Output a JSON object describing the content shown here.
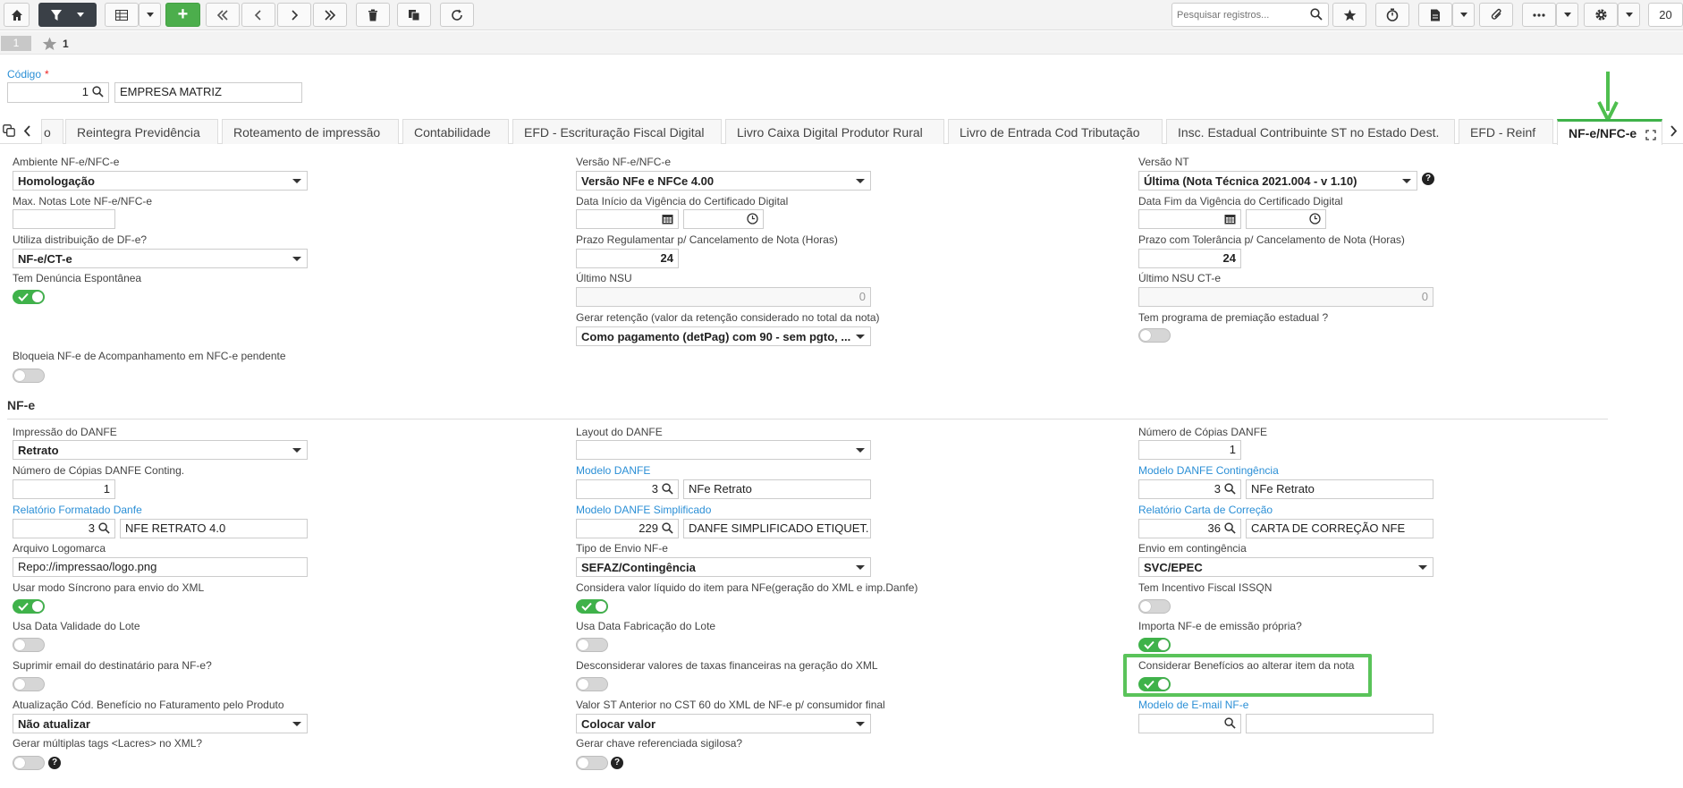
{
  "toolbar": {
    "search_placeholder": "Pesquisar registros...",
    "page_size": "20",
    "icons": [
      "home-icon",
      "filter-icon",
      "table-icon",
      "plus-icon",
      "first-icon",
      "prev-icon",
      "next-icon",
      "last-icon",
      "trash-icon",
      "copy-icon",
      "refresh-icon",
      "star-icon",
      "timer-icon",
      "document-icon",
      "paperclip-icon",
      "ellipsis-icon",
      "gear-icon"
    ],
    "add_label": "+"
  },
  "record_bar": {
    "tab_number": "1",
    "favorite_count": "1"
  },
  "header": {
    "code_label": "Código",
    "required_mark": "*",
    "code_value": "1",
    "company_name": "EMPRESA MATRIZ"
  },
  "tabs": [
    {
      "label": "o"
    },
    {
      "label": "Reintegra Previdência"
    },
    {
      "label": "Roteamento de impressão"
    },
    {
      "label": "Contabilidade"
    },
    {
      "label": "EFD - Escrituração Fiscal Digital"
    },
    {
      "label": "Livro Caixa Digital Produtor Rural"
    },
    {
      "label": "Livro de Entrada Cod Tributação"
    },
    {
      "label": "Insc. Estadual Contribuinte ST no Estado Dest."
    },
    {
      "label": "EFD - Reinf"
    },
    {
      "label": "NF-e/NFC-e",
      "active": true
    }
  ],
  "general": {
    "ambiente_label": "Ambiente NF-e/NFC-e",
    "ambiente_value": "Homologação",
    "versao_label": "Versão NF-e/NFC-e",
    "versao_value": "Versão NFe e NFCe 4.00",
    "versao_nt_label": "Versão NT",
    "versao_nt_value": "Última (Nota Técnica 2021.004 - v 1.10)",
    "max_notas_label": "Max. Notas Lote NF-e/NFC-e",
    "max_notas_value": "",
    "data_inicio_label": "Data Início da Vigência do Certificado Digital",
    "data_fim_label": "Data Fim da Vigência do Certificado Digital",
    "utiliza_dist_label": "Utiliza distribuição de DF-e?",
    "utiliza_dist_value": "NF-e/CT-e",
    "prazo_reg_label": "Prazo Regulamentar p/ Cancelamento de Nota (Horas)",
    "prazo_reg_value": "24",
    "prazo_tol_label": "Prazo com Tolerância p/ Cancelamento de Nota (Horas)",
    "prazo_tol_value": "24",
    "denuncia_label": "Tem Denúncia Espontânea",
    "denuncia_on": true,
    "ultimo_nsu_label": "Último NSU",
    "ultimo_nsu_value": "0",
    "ultimo_nsu_cte_label": "Último NSU CT-e",
    "ultimo_nsu_cte_value": "0",
    "gerar_retencao_label": "Gerar retenção (valor da retenção considerado no total da nota)",
    "gerar_retencao_value": "Como pagamento (detPag) com 90 - sem pgto, ...",
    "premiacao_label": "Tem programa de premiação estadual ?",
    "premiacao_on": false,
    "bloqueia_label": "Bloqueia NF-e de Acompanhamento em NFC-e pendente",
    "bloqueia_on": false
  },
  "nfe": {
    "section_title": "NF-e",
    "impressao_label": "Impressão do DANFE",
    "impressao_value": "Retrato",
    "layout_label": "Layout do DANFE",
    "layout_value": "",
    "num_copias_label": "Número de Cópias DANFE",
    "num_copias_value": "1",
    "num_copias_cont_label": "Número de Cópias DANFE Conting.",
    "num_copias_cont_value": "1",
    "modelo_danfe_label": "Modelo DANFE",
    "modelo_danfe_code": "3",
    "modelo_danfe_desc": "NFe Retrato",
    "modelo_cont_label": "Modelo DANFE Contingência",
    "modelo_cont_code": "3",
    "modelo_cont_desc": "NFe Retrato",
    "relatorio_label": "Relatório Formatado Danfe",
    "relatorio_code": "3",
    "relatorio_desc": "NFE RETRATO 4.0",
    "modelo_simpl_label": "Modelo DANFE Simplificado",
    "modelo_simpl_code": "229",
    "modelo_simpl_desc": "DANFE SIMPLIFICADO ETIQUET.",
    "rel_carta_label": "Relatório Carta de Correção",
    "rel_carta_code": "36",
    "rel_carta_desc": "CARTA DE CORREÇÃO NFE",
    "arquivo_logo_label": "Arquivo Logomarca",
    "arquivo_logo_value": "Repo://impressao/logo.png",
    "tipo_envio_label": "Tipo de Envio NF-e",
    "tipo_envio_value": "SEFAZ/Contingência",
    "envio_cont_label": "Envio em contingência",
    "envio_cont_value": "SVC/EPEC",
    "sincrono_label": "Usar modo Síncrono para envio do XML",
    "sincrono_on": true,
    "valor_liquido_label": "Considera valor líquido do item para NFe(geração do XML e imp.Danfe)",
    "valor_liquido_on": true,
    "incentivo_label": "Tem Incentivo Fiscal ISSQN",
    "incentivo_on": false,
    "validade_lote_label": "Usa Data Validade do Lote",
    "validade_lote_on": false,
    "fabricacao_lote_label": "Usa Data Fabricação do Lote",
    "fabricacao_lote_on": false,
    "importa_label": "Importa NF-e de emissão própria?",
    "importa_on": true,
    "suprimir_label": "Suprimir email do destinatário para NF-e?",
    "suprimir_on": false,
    "desconsiderar_label": "Desconsiderar valores de taxas financeiras na geração do XML",
    "desconsiderar_on": false,
    "beneficios_label": "Considerar Benefícios ao alterar item da nota",
    "beneficios_on": true,
    "atualizacao_label": "Atualização Cód. Benefício no Faturamento pelo Produto",
    "atualizacao_value": "Não atualizar",
    "valor_st_label": "Valor ST Anterior no CST 60 do XML de NF-e p/ consumidor final",
    "valor_st_value": "Colocar valor",
    "modelo_email_label": "Modelo de E-mail NF-e",
    "modelo_email_code": "",
    "modelo_email_desc": "",
    "lacres_label": "Gerar múltiplas tags <Lacres> no XML?",
    "lacres_on": false,
    "chave_label": "Gerar chave referenciada sigilosa?",
    "chave_on": false
  },
  "colors": {
    "accent": "#3fb24a",
    "link": "#2b8fd6",
    "highlight": "#5ac35a"
  }
}
